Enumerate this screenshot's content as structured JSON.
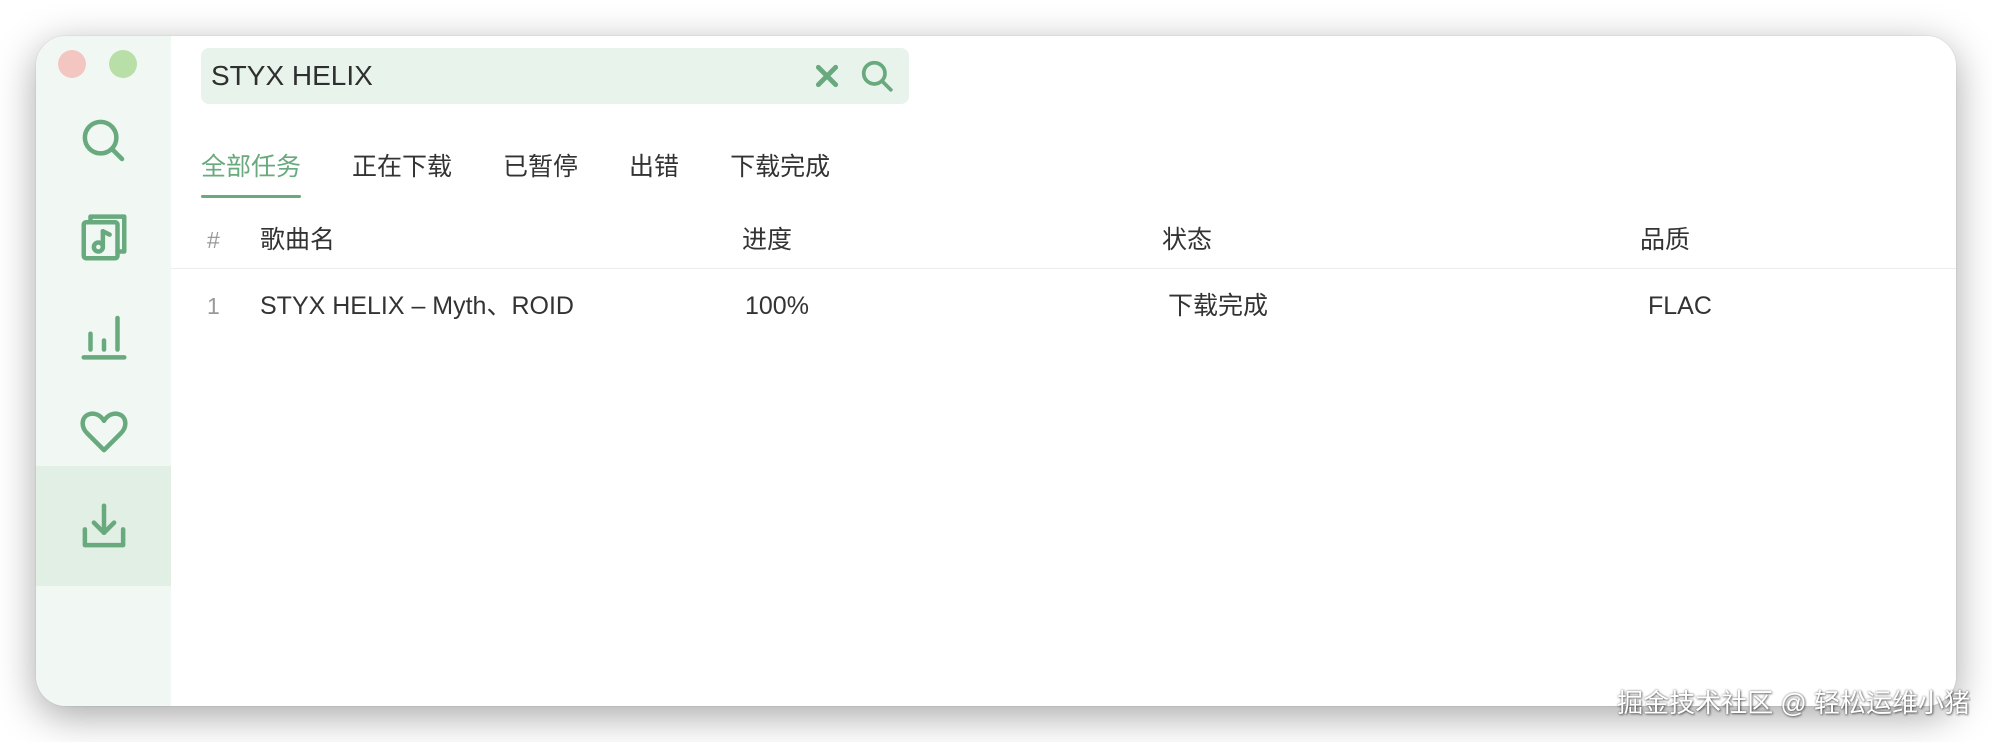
{
  "colors": {
    "accent": "#68a97e",
    "sidebar_bg": "#f1f8f3",
    "sidebar_active_bg": "#e1efe5",
    "search_bg": "#e8f3ec",
    "close_button": "#f4c6c1",
    "maximize_button": "#b9dfa8"
  },
  "sidebar": {
    "items": [
      {
        "icon": "search-icon",
        "active": false
      },
      {
        "icon": "music-file-icon",
        "active": false
      },
      {
        "icon": "bar-chart-icon",
        "active": false
      },
      {
        "icon": "heart-icon",
        "active": false
      },
      {
        "icon": "download-icon",
        "active": true
      }
    ]
  },
  "search": {
    "value": "STYX HELIX",
    "clear_icon": "close-icon",
    "search_icon": "search-icon"
  },
  "tabs": [
    {
      "label": "全部任务",
      "active": true
    },
    {
      "label": "正在下载",
      "active": false
    },
    {
      "label": "已暂停",
      "active": false
    },
    {
      "label": "出错",
      "active": false
    },
    {
      "label": "下载完成",
      "active": false
    }
  ],
  "table": {
    "headers": {
      "index": "#",
      "name": "歌曲名",
      "progress": "进度",
      "status": "状态",
      "quality": "品质"
    },
    "rows": [
      {
        "index": "1",
        "name": "STYX HELIX – Myth、ROID",
        "progress": "100%",
        "status": "下载完成",
        "quality": "FLAC"
      }
    ]
  },
  "watermark": "掘金技术社区 @ 轻松运维小猪"
}
